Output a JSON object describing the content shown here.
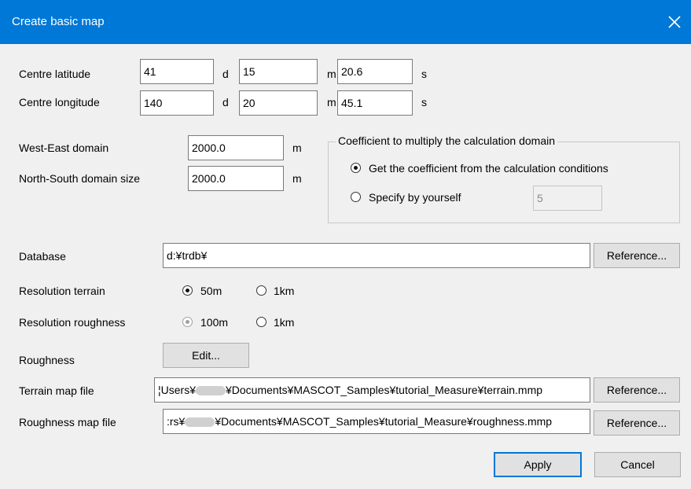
{
  "window": {
    "title": "Create basic map"
  },
  "coords": {
    "lat_label": "Centre latitude",
    "lon_label": "Centre longitude",
    "lat": {
      "d": "41",
      "m": "15",
      "s": "20.6"
    },
    "lon": {
      "d": "140",
      "m": "20",
      "s": "45.1"
    },
    "d_unit": "d",
    "m_unit": "m",
    "s_unit": "s"
  },
  "domain": {
    "we_label": "West-East domain",
    "ns_label": "North-South domain size",
    "we_value": "2000.0",
    "ns_value": "2000.0",
    "unit": "m"
  },
  "coefficient": {
    "legend": "Coefficient to multiply the calculation domain",
    "option_conditions": "Get the coefficient from the calculation conditions",
    "option_self": "Specify by yourself",
    "selected": "conditions",
    "value": "5"
  },
  "database": {
    "label": "Database",
    "value": "d:¥trdb¥",
    "button": "Reference..."
  },
  "resolution_terrain": {
    "label": "Resolution terrain",
    "opt1": "50m",
    "opt2": "1km",
    "selected": "50m"
  },
  "resolution_roughness": {
    "label": "Resolution roughness",
    "opt1": "100m",
    "opt2": "1km",
    "selected": "100m"
  },
  "roughness": {
    "label": "Roughness",
    "button": "Edit..."
  },
  "terrain_file": {
    "label": "Terrain map file",
    "value_a": "¦Users¥",
    "value_b": "¥Documents¥MASCOT_Samples¥tutorial_Measure¥terrain.mmp",
    "button": "Reference..."
  },
  "roughness_file": {
    "label": "Roughness map file",
    "value_a": ":rs¥",
    "value_b": "¥Documents¥MASCOT_Samples¥tutorial_Measure¥roughness.mmp",
    "button": "Reference..."
  },
  "actions": {
    "apply": "Apply",
    "cancel": "Cancel"
  }
}
